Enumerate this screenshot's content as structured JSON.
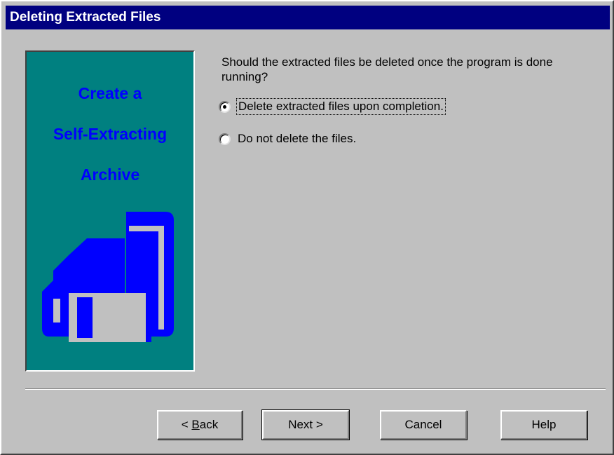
{
  "dialog": {
    "title": "Deleting Extracted Files"
  },
  "banner": {
    "line1": "Create a",
    "line2": "Self-Extracting",
    "line3": "Archive",
    "text_color": "#0000ff",
    "background": "#008080",
    "icon": "floppy-disk-icon"
  },
  "content": {
    "question": "Should the extracted files be deleted once the program is done running?",
    "options": [
      {
        "label": "Delete extracted files upon completion.",
        "selected": true
      },
      {
        "label": "Do not delete the files.",
        "selected": false
      }
    ]
  },
  "buttons": {
    "back_prefix": "< ",
    "back_mnemonic": "B",
    "back_rest": "ack",
    "next": "Next >",
    "cancel": "Cancel",
    "help": "Help"
  }
}
